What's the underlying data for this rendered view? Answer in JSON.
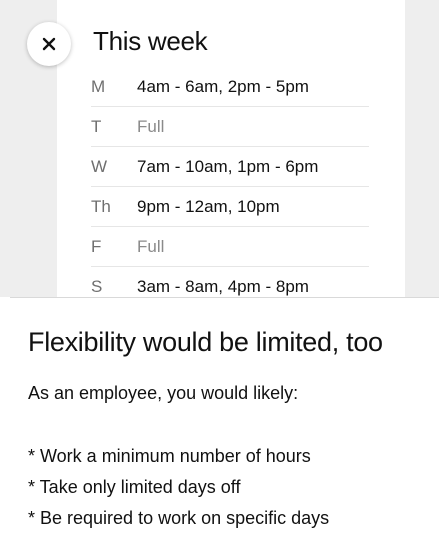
{
  "card": {
    "title": "This week",
    "close_icon": "close-icon",
    "schedule": [
      {
        "day": "M",
        "hours": "4am - 6am, 2pm - 5pm"
      },
      {
        "day": "T",
        "hours": "Full"
      },
      {
        "day": "W",
        "hours": "7am - 10am, 1pm - 6pm"
      },
      {
        "day": "Th",
        "hours": "9pm - 12am, 10pm"
      },
      {
        "day": "F",
        "hours": "Full"
      },
      {
        "day": "S",
        "hours": "3am - 8am, 4pm - 8pm"
      }
    ]
  },
  "content": {
    "heading": "Flexibility would be limited, too",
    "intro": "As an employee, you would likely:",
    "bullets": [
      "* Work a minimum number of hours",
      "* Take only limited days off",
      "* Be required to work on specific days"
    ]
  },
  "colors": {
    "background_band": "#eeeeee",
    "text_primary": "#111111",
    "text_muted": "#8a8a8a"
  }
}
